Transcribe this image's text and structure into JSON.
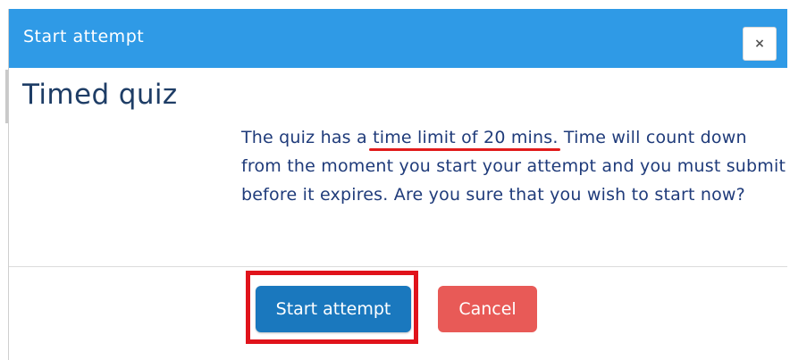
{
  "modal": {
    "title": "Start attempt",
    "close_label": "×",
    "heading": "Timed quiz",
    "message_before": "The quiz has a ",
    "message_highlight": "time limit of 20 mins.",
    "message_after": " Time will count down from the moment you start your attempt and you must submit before it expires. Are you sure that you wish to start now?",
    "start_button_label": "Start attempt",
    "cancel_button_label": "Cancel"
  },
  "colors": {
    "header": "#2f9ae6",
    "heading_text": "#1e3d66",
    "body_text": "#1f3b7a",
    "start_button": "#1a78be",
    "cancel_button": "#e85a57",
    "annotation_red": "#e0131b"
  },
  "icons": {
    "close": "close-icon"
  }
}
